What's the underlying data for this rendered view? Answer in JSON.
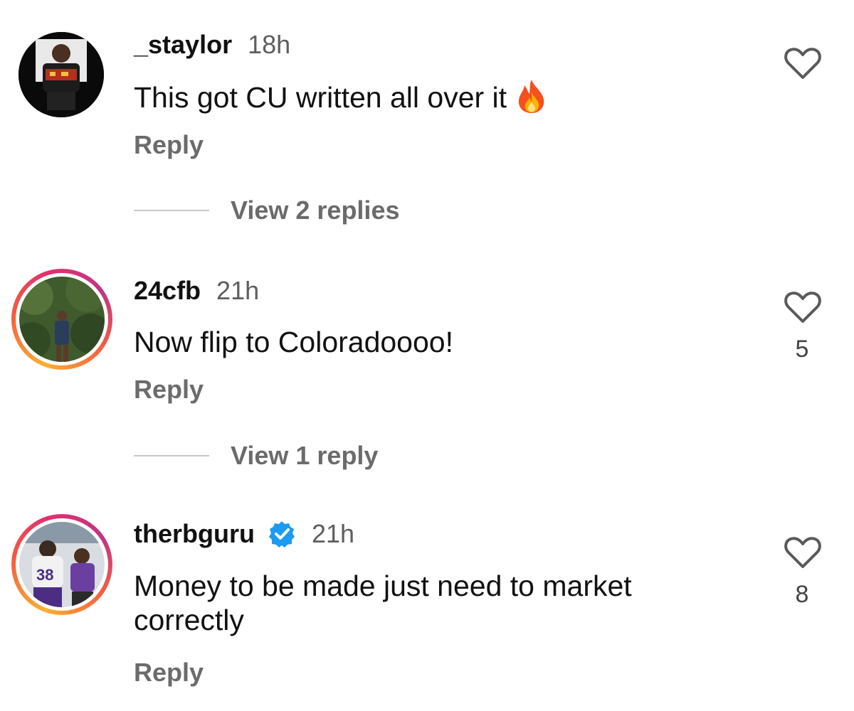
{
  "comments": [
    {
      "username": "_staylor",
      "time": "18h",
      "text": "This got CU written all over it",
      "emoji": "fire-emoji",
      "reply_label": "Reply",
      "view_replies": "View 2 replies",
      "likes": ""
    },
    {
      "username": "24cfb",
      "time": "21h",
      "text": "Now flip to Coloradoooo!",
      "reply_label": "Reply",
      "view_replies": "View 1 reply",
      "likes": "5"
    },
    {
      "username": "therbguru",
      "verified": true,
      "time": "21h",
      "text": "Money to be made just need to market correctly",
      "reply_label": "Reply",
      "likes": "8"
    }
  ],
  "colors": {
    "verified_blue": "#1d9bf0",
    "muted_text": "#6b6b6b"
  }
}
